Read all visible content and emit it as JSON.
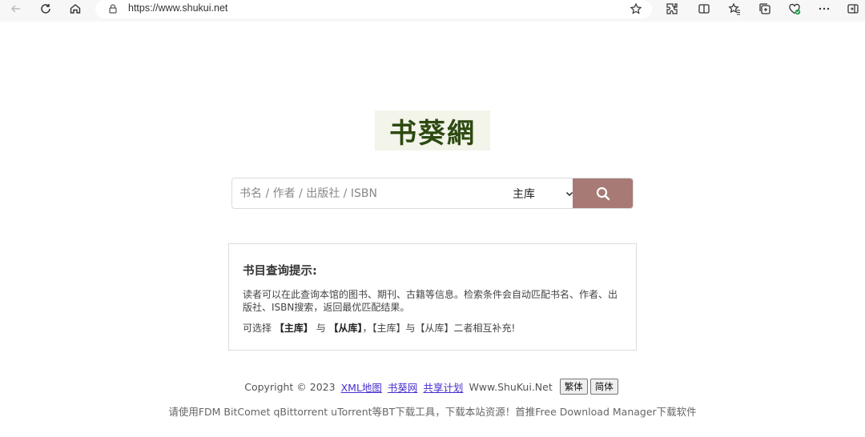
{
  "browser": {
    "url": "https://www.shukui.net",
    "icons": [
      "back-icon",
      "refresh-icon",
      "home-icon",
      "lock-icon",
      "favorite-star-icon",
      "extensions-icon",
      "split-screen-icon",
      "favorites-icon",
      "collections-icon",
      "health-icon",
      "more-icon",
      "sidebar-icon"
    ]
  },
  "logo": {
    "text": "书葵網"
  },
  "search": {
    "placeholder": "书名 / 作者 / 出版社 / ISBN",
    "value": "",
    "library_selected": "主库",
    "button_color": "#a87a76"
  },
  "tips": {
    "title": "书目查询提示:",
    "desc": "读者可以在此查询本馆的图书、期刊、古籍等信息。检索条件会自动匹配书名、作者、出版社、ISBN搜索，返回最优匹配结果。",
    "line2_prefix": "可选择",
    "line2_main": "【主库】",
    "line2_and": "与",
    "line2_sub": "【从库】",
    "line2_suffix": "，【主库】与【从库】二者相互补充!"
  },
  "footer": {
    "copyright": "Copyright © 2023",
    "links": [
      "XML地图",
      "书葵网",
      "共享计划"
    ],
    "site": "Www.ShuKui.Net",
    "btn_traditional": "繁体",
    "btn_simplified": "简体",
    "note": "请使用FDM BitComet qBittorrent uTorrent等BT下载工具，下载本站资源！首推Free Download Manager下载软件"
  }
}
